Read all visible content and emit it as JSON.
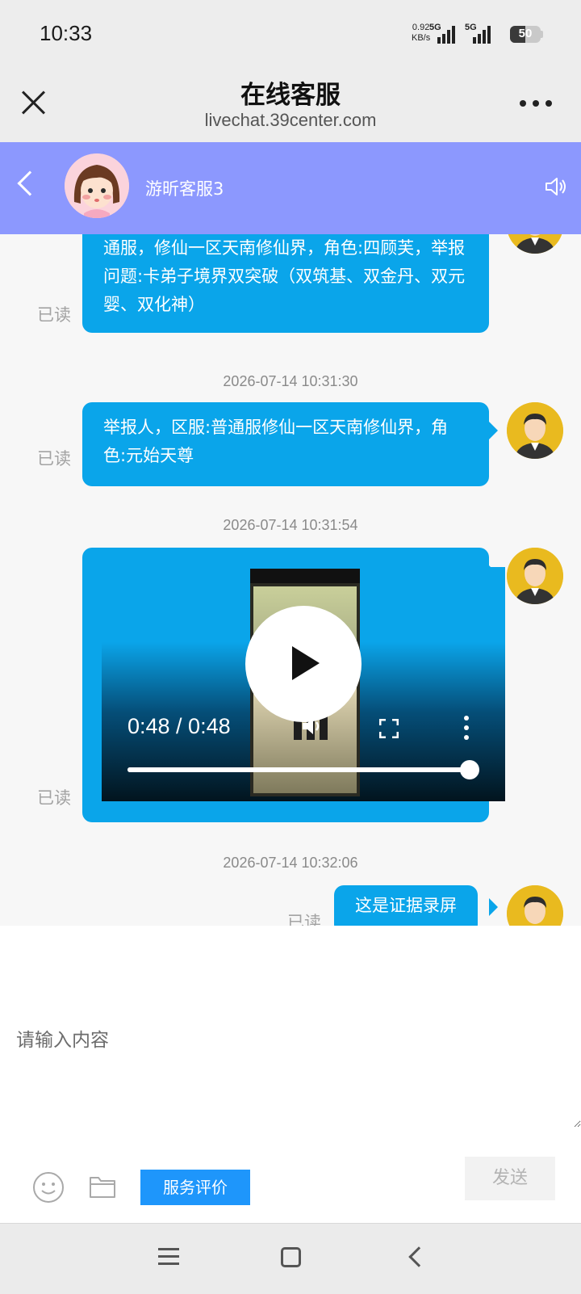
{
  "status_bar": {
    "time": "10:33",
    "net_speed_value": "0.92",
    "net_speed_unit": "KB/s",
    "signal_1_label": "5G",
    "signal_2_label": "5G",
    "battery": "50",
    "battery_level": 0.5
  },
  "browser": {
    "title": "在线客服",
    "url": "livechat.39center.com",
    "close_icon": "close-icon",
    "more_icon": "more-icon"
  },
  "chat_header": {
    "agent_name": "游昕客服3",
    "back_icon": "chevron-left-icon",
    "speaker_icon": "speaker-icon"
  },
  "messages": [
    {
      "text": "通服，修仙一区天南修仙界，角色:四顾芙，举报问题:卡弟子境界双突破（双筑基、双金丹、双元婴、双化神）",
      "read": "已读"
    },
    {
      "timestamp": "2026-07-14 10:31:30",
      "text": "举报人，区服:普通服修仙一区天南修仙界，角色:元始天尊",
      "read": "已读"
    },
    {
      "timestamp": "2026-07-14 10:31:54",
      "type": "video",
      "read": "已读"
    },
    {
      "timestamp": "2026-07-14 10:32:06",
      "text": "这是证据录屏",
      "read": "已读"
    }
  ],
  "video": {
    "time_display": "0:48 / 0:48",
    "progress": 1.0
  },
  "input": {
    "placeholder": "请输入内容",
    "rate_label": "服务评价",
    "send_label": "发送"
  },
  "colors": {
    "chat_header_bg": "#8c98fe",
    "bubble_bg": "#0aa5ea",
    "rate_button_bg": "#1e96fb"
  }
}
